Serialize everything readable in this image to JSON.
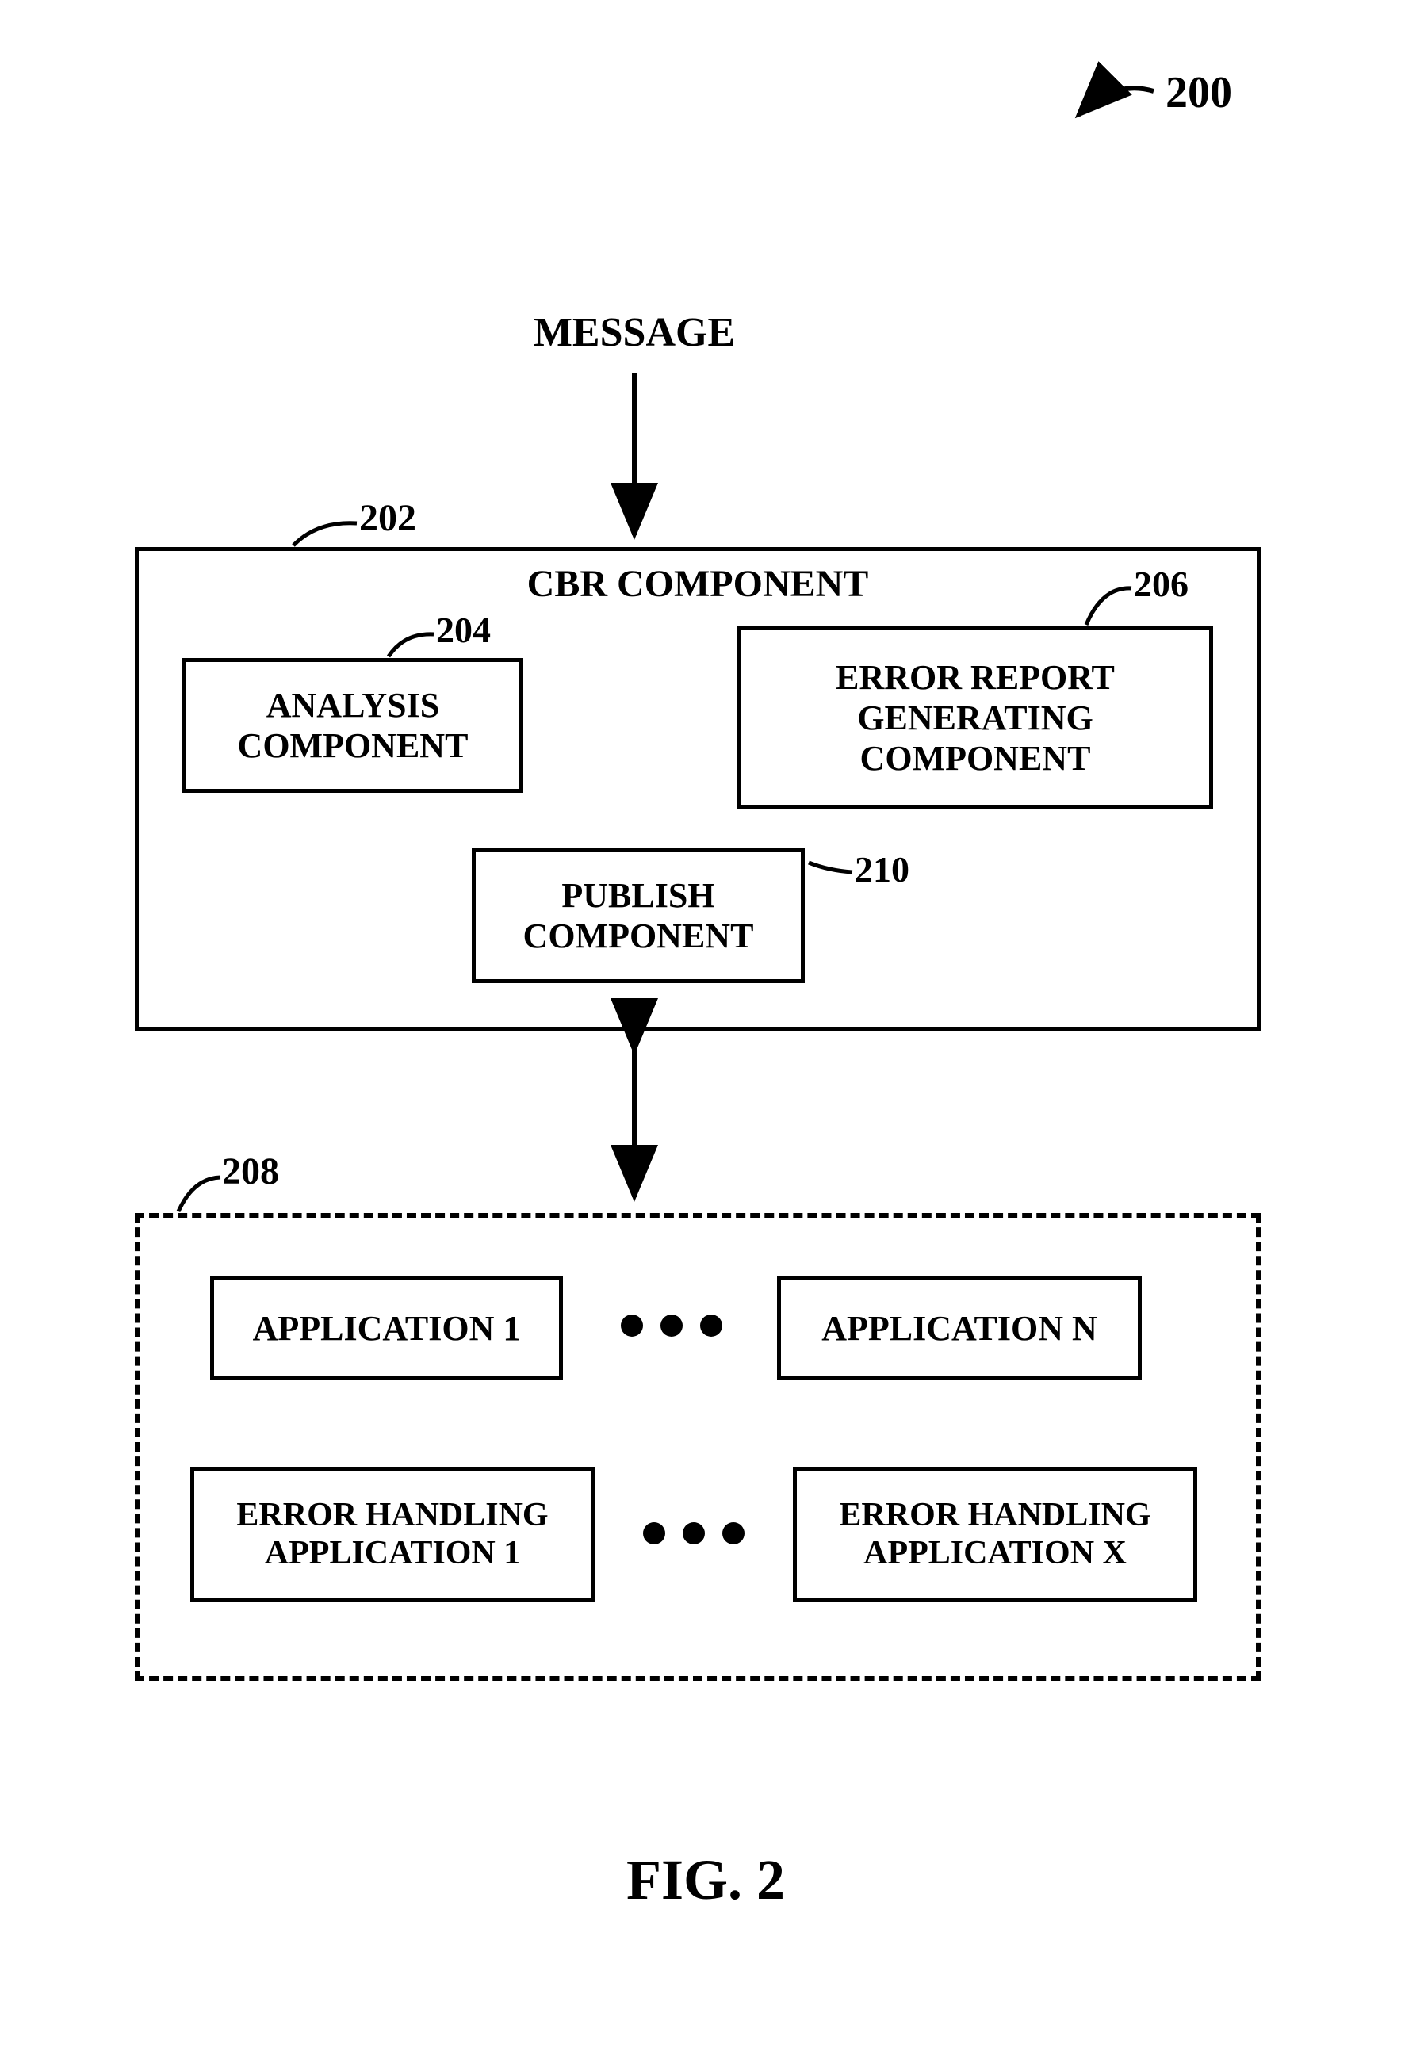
{
  "figure": {
    "ref_main": "200",
    "caption": "FIG. 2",
    "message_label": "MESSAGE",
    "cbr": {
      "ref": "202",
      "title": "CBR COMPONENT",
      "analysis": {
        "ref": "204",
        "label": "ANALYSIS COMPONENT"
      },
      "error_gen": {
        "ref": "206",
        "label": "ERROR REPORT GENERATING COMPONENT"
      },
      "publish": {
        "ref": "210",
        "label": "PUBLISH COMPONENT"
      }
    },
    "apps": {
      "ref": "208",
      "app1": "APPLICATION 1",
      "appn": "APPLICATION N",
      "err1": "ERROR HANDLING APPLICATION 1",
      "errx": "ERROR HANDLING APPLICATION X"
    }
  }
}
